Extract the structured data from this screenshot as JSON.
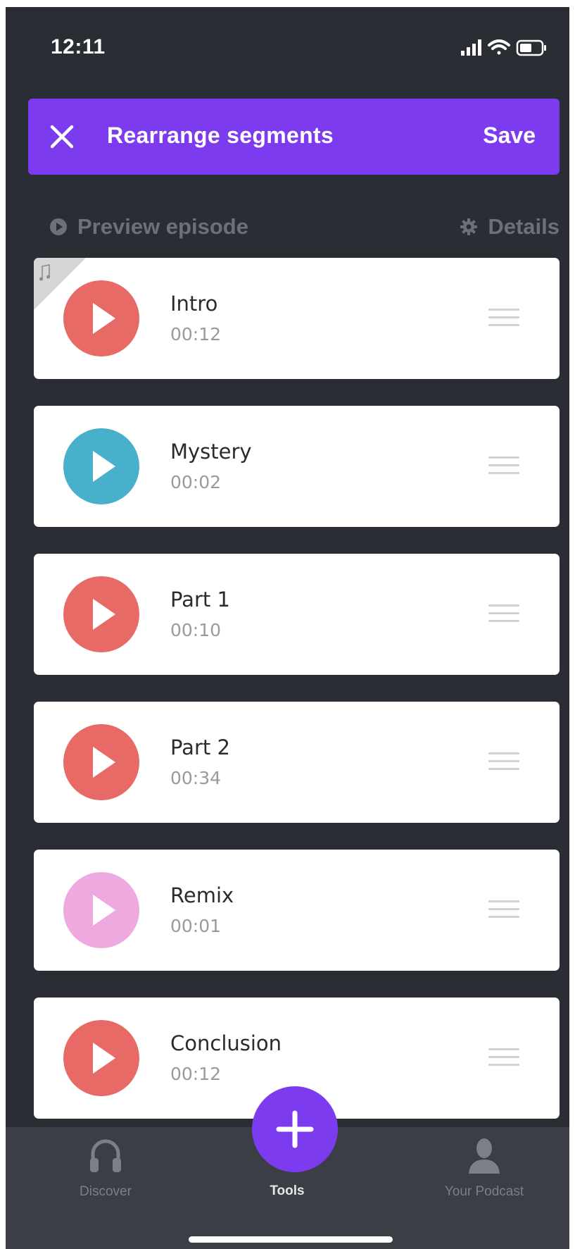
{
  "status_bar": {
    "time": "12:11"
  },
  "header": {
    "title": "Rearrange segments",
    "save_label": "Save"
  },
  "sub_bar": {
    "preview_label": "Preview episode",
    "details_label": "Details"
  },
  "segments": [
    {
      "title": "Intro",
      "duration": "00:12",
      "color": "#e86a66",
      "music_tag": true
    },
    {
      "title": "Mystery",
      "duration": "00:02",
      "color": "#49b0cc",
      "music_tag": false
    },
    {
      "title": "Part 1",
      "duration": "00:10",
      "color": "#e86a66",
      "music_tag": false
    },
    {
      "title": "Part 2",
      "duration": "00:34",
      "color": "#e86a66",
      "music_tag": false
    },
    {
      "title": "Remix",
      "duration": "00:01",
      "color": "#eeaadf",
      "music_tag": false
    },
    {
      "title": "Conclusion",
      "duration": "00:12",
      "color": "#e86a66",
      "music_tag": false
    }
  ],
  "tabs": {
    "discover": "Discover",
    "tools": "Tools",
    "your_podcast": "Your Podcast"
  },
  "colors": {
    "accent": "#7d3bf0",
    "background": "#2a2d34",
    "tab_bar": "#3b3e45"
  },
  "icons": [
    "close-icon",
    "play-circle-icon",
    "gear-icon",
    "music-note-icon",
    "play-icon",
    "drag-handle-icon",
    "headphones-icon",
    "plus-icon",
    "person-icon",
    "signal-icon",
    "wifi-icon",
    "battery-icon"
  ]
}
